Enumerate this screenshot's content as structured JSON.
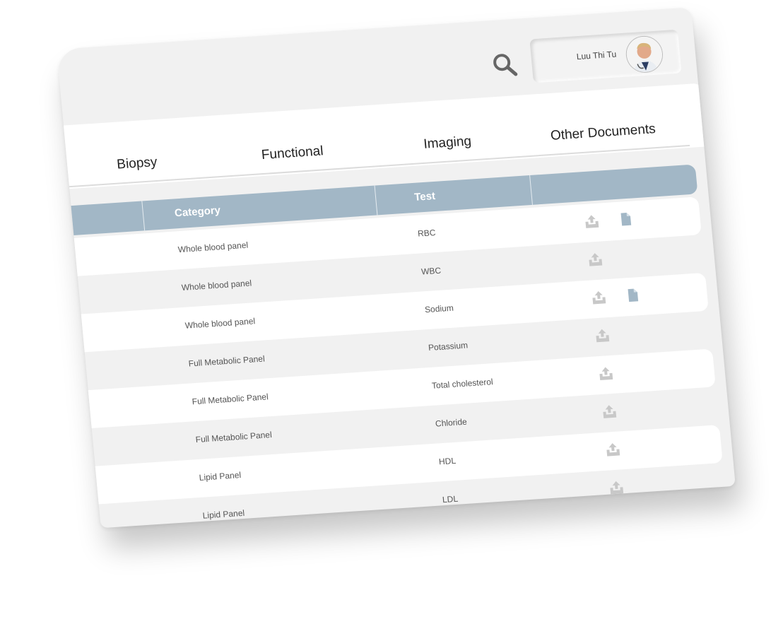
{
  "header": {
    "user_name": "Luu Thi Tu"
  },
  "tabs": [
    {
      "label": "Biopsy"
    },
    {
      "label": "Functional"
    },
    {
      "label": "Imaging"
    },
    {
      "label": "Other Documents"
    }
  ],
  "table": {
    "columns": [
      "Category",
      "Test"
    ],
    "rows": [
      {
        "category": "Whole blood panel",
        "test": "RBC",
        "has_document": true
      },
      {
        "category": "Whole blood panel",
        "test": "WBC",
        "has_document": false
      },
      {
        "category": "Whole blood panel",
        "test": "Sodium",
        "has_document": true
      },
      {
        "category": "Full Metabolic Panel",
        "test": "Potassium",
        "has_document": false
      },
      {
        "category": "Full Metabolic Panel",
        "test": "Total cholesterol",
        "has_document": false
      },
      {
        "category": "Full Metabolic Panel",
        "test": "Chloride",
        "has_document": false
      },
      {
        "category": "Lipid Panel",
        "test": "HDL",
        "has_document": false
      },
      {
        "category": "Lipid Panel",
        "test": "LDL",
        "has_document": false
      }
    ]
  },
  "colors": {
    "header_accent": "#a2b7c6",
    "upload_icon": "#c8c8c8",
    "document_icon": "#a2b7c6"
  },
  "icons": [
    "search-icon",
    "upload-icon",
    "document-icon"
  ]
}
